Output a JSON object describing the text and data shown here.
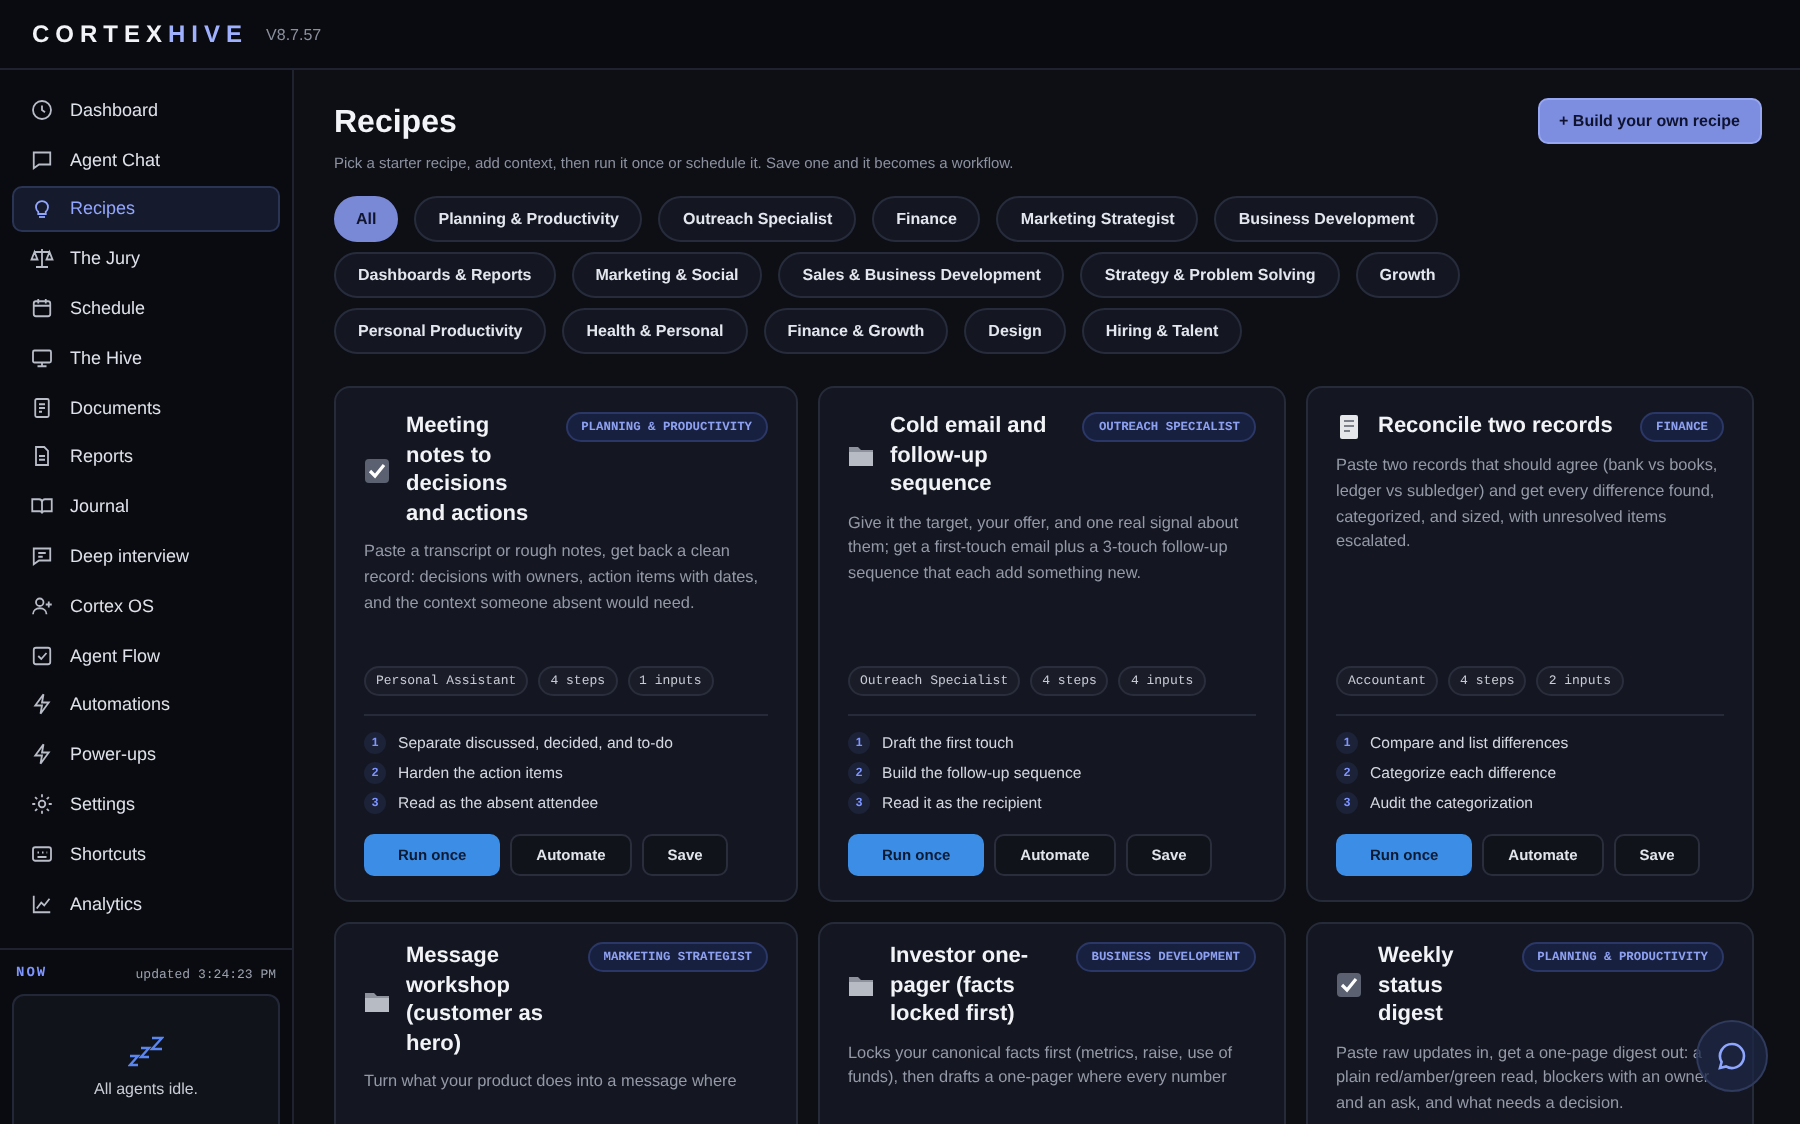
{
  "brand": {
    "primary": "CORTEX",
    "accent": "HIVE",
    "version": "V8.7.57"
  },
  "sidebar": {
    "items": [
      {
        "label": "Dashboard",
        "selected": false
      },
      {
        "label": "Agent Chat",
        "selected": false
      },
      {
        "label": "Recipes",
        "selected": true
      },
      {
        "label": "The Jury",
        "selected": false
      },
      {
        "label": "Schedule",
        "selected": false
      },
      {
        "label": "The Hive",
        "selected": false
      },
      {
        "label": "Documents",
        "selected": false
      },
      {
        "label": "Reports",
        "selected": false
      },
      {
        "label": "Journal",
        "selected": false
      },
      {
        "label": "Deep interview",
        "selected": false
      },
      {
        "label": "Cortex OS",
        "selected": false
      },
      {
        "label": "Agent Flow",
        "selected": false
      },
      {
        "label": "Automations",
        "selected": false
      },
      {
        "label": "Power-ups",
        "selected": false
      },
      {
        "label": "Settings",
        "selected": false
      },
      {
        "label": "Shortcuts",
        "selected": false
      },
      {
        "label": "Analytics",
        "selected": false
      }
    ],
    "now": {
      "label": "NOW",
      "updated": "updated 3:24:23 PM",
      "status": "All agents idle."
    }
  },
  "page": {
    "title": "Recipes",
    "subtitle": "Pick a starter recipe, add context, then run it once or schedule it. Save one and it becomes a workflow.",
    "build_button": "+ Build your own recipe"
  },
  "filters": [
    {
      "label": "All",
      "selected": true
    },
    {
      "label": "Planning & Productivity",
      "selected": false
    },
    {
      "label": "Outreach Specialist",
      "selected": false
    },
    {
      "label": "Finance",
      "selected": false
    },
    {
      "label": "Marketing Strategist",
      "selected": false
    },
    {
      "label": "Business Development",
      "selected": false
    },
    {
      "label": "Dashboards & Reports",
      "selected": false
    },
    {
      "label": "Marketing & Social",
      "selected": false
    },
    {
      "label": "Sales & Business Development",
      "selected": false
    },
    {
      "label": "Strategy & Problem Solving",
      "selected": false
    },
    {
      "label": "Growth",
      "selected": false
    },
    {
      "label": "Personal Productivity",
      "selected": false
    },
    {
      "label": "Health & Personal",
      "selected": false
    },
    {
      "label": "Finance & Growth",
      "selected": false
    },
    {
      "label": "Design",
      "selected": false
    },
    {
      "label": "Hiring & Talent",
      "selected": false
    }
  ],
  "recipes": [
    {
      "kind": "checklist",
      "title": "Meeting notes to decisions and actions",
      "badge": "PLANNING & PRODUCTIVITY",
      "description": "Paste a transcript or rough notes, get back a clean record: decisions with owners, action items with dates, and the context someone absent would need.",
      "tags": [
        "Personal Assistant",
        "4 steps",
        "1 inputs"
      ],
      "steps": [
        {
          "number": "1",
          "text": "Separate discussed, decided, and to-do"
        },
        {
          "number": "2",
          "text": "Harden the action items"
        },
        {
          "number": "3",
          "text": "Read as the absent attendee"
        }
      ],
      "buttons": [
        {
          "label": "Run once",
          "kind": "primary"
        },
        {
          "label": "Automate",
          "kind": "secondary"
        },
        {
          "label": "Save",
          "kind": "secondary"
        }
      ]
    },
    {
      "kind": "folder",
      "title": "Cold email and follow-up sequence",
      "badge": "OUTREACH SPECIALIST",
      "description": "Give it the target, your offer, and one real signal about them; get a first-touch email plus a 3-touch follow-up sequence that each add something new.",
      "tags": [
        "Outreach Specialist",
        "4 steps",
        "4 inputs"
      ],
      "steps": [
        {
          "number": "1",
          "text": "Draft the first touch"
        },
        {
          "number": "2",
          "text": "Build the follow-up sequence"
        },
        {
          "number": "3",
          "text": "Read it as the recipient"
        }
      ],
      "buttons": [
        {
          "label": "Run once",
          "kind": "primary"
        },
        {
          "label": "Automate",
          "kind": "secondary"
        },
        {
          "label": "Save",
          "kind": "secondary"
        }
      ]
    },
    {
      "kind": "ledger",
      "title": "Reconcile two records",
      "badge": "FINANCE",
      "description": "Paste two records that should agree (bank vs books, ledger vs subledger) and get every difference found, categorized, and sized, with unresolved items escalated.",
      "tags": [
        "Accountant",
        "4 steps",
        "2 inputs"
      ],
      "steps": [
        {
          "number": "1",
          "text": "Compare and list differences"
        },
        {
          "number": "2",
          "text": "Categorize each difference"
        },
        {
          "number": "3",
          "text": "Audit the categorization"
        }
      ],
      "buttons": [
        {
          "label": "Run once",
          "kind": "primary"
        },
        {
          "label": "Automate",
          "kind": "secondary"
        },
        {
          "label": "Save",
          "kind": "secondary"
        }
      ]
    },
    {
      "kind": "folder",
      "title": "Message workshop (customer as hero)",
      "badge": "MARKETING STRATEGIST",
      "description": "Turn what your product does into a message where"
    },
    {
      "kind": "folder",
      "title": "Investor one-pager (facts locked first)",
      "badge": "BUSINESS DEVELOPMENT",
      "description": "Locks your canonical facts first (metrics, raise, use of funds), then drafts a one-pager where every number"
    },
    {
      "kind": "checklist",
      "title": "Weekly status digest",
      "badge": "PLANNING & PRODUCTIVITY",
      "description": "Paste raw updates in, get a one-page digest out: a plain red/amber/green read, blockers with an owner and an ask, and what needs a decision."
    }
  ]
}
